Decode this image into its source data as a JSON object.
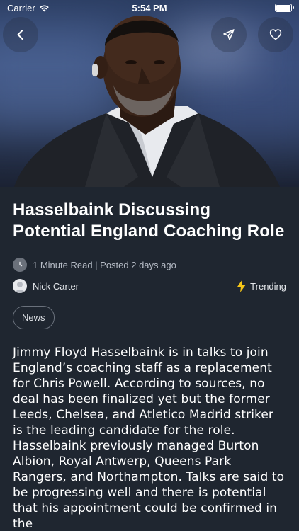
{
  "status_bar": {
    "carrier": "Carrier",
    "time": "5:54 PM"
  },
  "article": {
    "title": "Hasselbaink Discussing Potential England Coaching Role",
    "read_time": "1 Minute Read | Posted 2 days ago",
    "author": "Nick Carter",
    "trending_label": "Trending",
    "tag": "News",
    "body": "Jimmy Floyd Hasselbaink is in talks to join England’s coaching staff as a replacement for Chris Powell. According to sources, no deal has been finalized yet but the former Leeds, Chelsea, and Atletico Madrid striker is the leading candidate for the role. Hasselbaink previously managed Burton Albion, Royal Antwerp, Queens Park Rangers, and Northampton. Talks are said to be progressing well and there is potential that his appointment could be confirmed in the"
  },
  "icons": {
    "back": "chevron-left-icon",
    "share": "send-icon",
    "favorite": "heart-icon",
    "clock": "clock-icon",
    "trending": "lightning-icon"
  },
  "colors": {
    "background": "#1f2630",
    "accent": "#f5c518",
    "muted_text": "#b6bcc6"
  }
}
